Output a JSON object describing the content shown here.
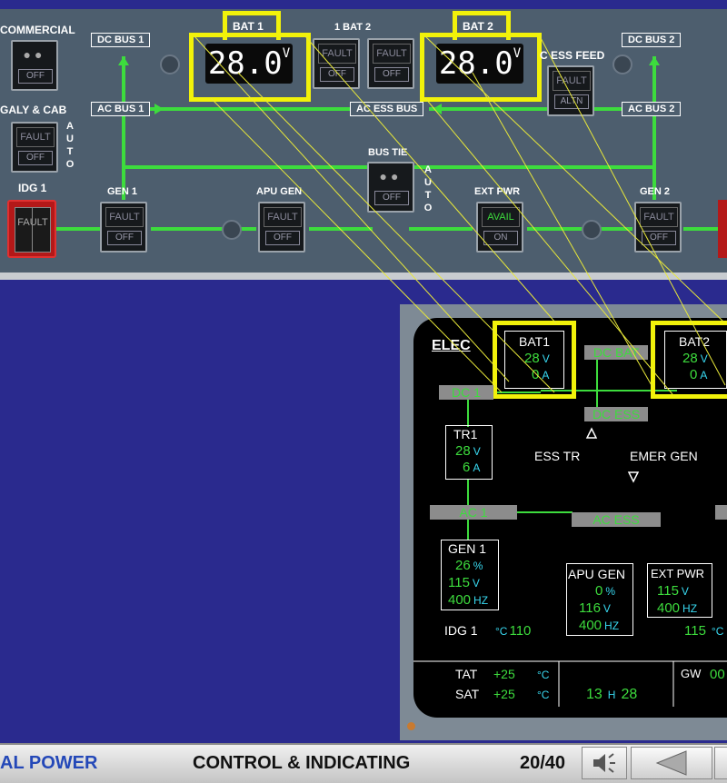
{
  "overhead": {
    "commercial_label": "COMMERCIAL",
    "galy_cab_label": "GALY & CAB",
    "auto_letters": [
      "A",
      "U",
      "T",
      "O"
    ],
    "idg1_label": "IDG 1",
    "dc_bus1_label": "DC BUS 1",
    "dc_bus2_label": "DC BUS 2",
    "ac_bus1_label": "AC BUS 1",
    "ac_bus2_label": "AC BUS 2",
    "ac_ess_bus_label": "AC ESS BUS",
    "bat1_label": "BAT 1",
    "bat2_label": "BAT 2",
    "bat_switch_label": "1  BAT  2",
    "bat1_voltage": "28.0",
    "bat2_voltage": "28.0",
    "volt_unit": "V",
    "c_ess_feed_label": "C ESS FEED",
    "bus_tie_label": "BUS TIE",
    "gen1_label": "GEN 1",
    "gen2_label": "GEN 2",
    "apu_gen_label": "APU GEN",
    "ext_pwr_label": "EXT PWR",
    "fault": "FAULT",
    "off": "OFF",
    "altn": "ALTN",
    "avail": "AVAIL",
    "on": "ON"
  },
  "ecam": {
    "title": "ELEC",
    "bat1_label": "BAT1",
    "bat2_label": "BAT2",
    "bat1_volts": "28",
    "bat2_volts": "28",
    "bat1_amps": "0",
    "bat2_amps": "0",
    "v_unit": "V",
    "a_unit": "A",
    "dc_bat": "DC BAT",
    "dc1": "DC 1",
    "dc_ess": "DC ESS",
    "tr1_label": "TR1",
    "tr1_volts": "28",
    "tr1_amps": "6",
    "ess_tr": "ESS TR",
    "emer_gen": "EMER GEN",
    "ac1": "AC 1",
    "ac_ess": "AC ESS",
    "gen1_label": "GEN 1",
    "gen1_pct": "26",
    "gen1_volts": "115",
    "gen1_hz": "400",
    "pct_unit": "%",
    "hz_unit": "HZ",
    "apu_gen_label": "APU GEN",
    "apu_pct": "0",
    "apu_volts": "116",
    "apu_hz": "400",
    "ext_pwr_label": "EXT PWR",
    "ext_volts": "115",
    "ext_hz": "400",
    "idg1_label": "IDG 1",
    "idg1_temp": "110",
    "idg2_temp": "115",
    "deg_c": "°C",
    "tat_label": "TAT",
    "tat_value": "+25",
    "sat_label": "SAT",
    "sat_value": "+25",
    "time_h": "13",
    "h_unit": "H",
    "time_m": "28",
    "gw_label": "GW",
    "gw_value": "00"
  },
  "footer": {
    "chapter": "AL POWER",
    "section": "CONTROL & INDICATING",
    "page": "20/40"
  },
  "colors": {
    "panel": "#4d5e6e",
    "background": "#2a2a8e",
    "highlight": "#f2f20a",
    "ecam_green": "#3ddc3d",
    "ecam_cyan": "#38d8f0"
  }
}
